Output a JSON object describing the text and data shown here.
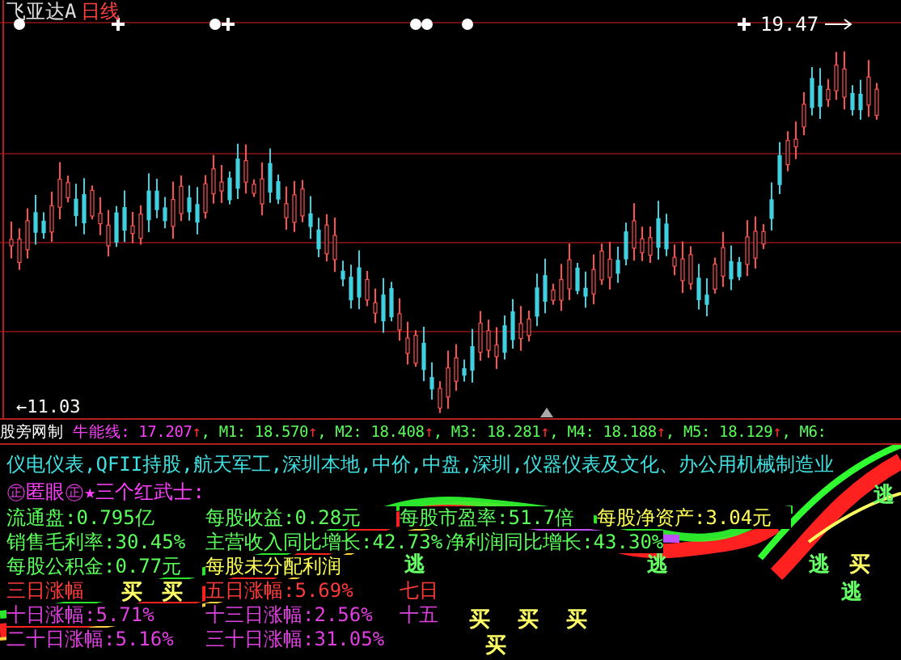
{
  "chart": {
    "stock": "飞亚达A",
    "period": "日线",
    "high_label": "19.47",
    "low_label": "←11.03"
  },
  "indicator": {
    "source": "股旁网制",
    "series": [
      {
        "label": "牛能线:",
        "value": " 17.207",
        "arrow": "↑",
        "sep": ", "
      },
      {
        "label": "M1:",
        "value": " 18.570",
        "arrow": "↑",
        "sep": ", "
      },
      {
        "label": "M2:",
        "value": " 18.408",
        "arrow": "↑",
        "sep": ", "
      },
      {
        "label": "M3:",
        "value": " 18.281",
        "arrow": "↑",
        "sep": ", "
      },
      {
        "label": "M4:",
        "value": " 18.188",
        "arrow": "↑",
        "sep": ", "
      },
      {
        "label": "M5:",
        "value": " 18.129",
        "arrow": "↑",
        "sep": ", "
      },
      {
        "label": "M6:"
      }
    ]
  },
  "tags": "仪电仪表,QFII持股,航天军工,深圳本地,中价,中盘,深圳,仪器仪表及文化、办公用机械制造业",
  "pattern": "㊣匿眼㊣★三个红武士:",
  "rows": [
    [
      {
        "kind": "fundamental",
        "text": "流通盘:0.795亿"
      },
      {
        "kind": "fundamental",
        "text": "每股收益:0.28元"
      },
      {
        "kind": "fundamental",
        "text": "每股市盈率:51.7倍"
      },
      {
        "kind": "highlight",
        "text": "每股净资产:3.04元"
      }
    ],
    [
      {
        "kind": "fundamental",
        "text": "销售毛利率:30.45%"
      },
      {
        "kind": "fundamental",
        "text": "主营收入同比增长:42.73%"
      },
      {
        "kind": "fundamental",
        "text": "净利润同比增长:43.30%"
      }
    ],
    [
      {
        "kind": "fundamental",
        "text": "每股公积金:0.77元"
      },
      {
        "kind": "highlight",
        "text": "每股未分配利润"
      }
    ],
    [
      {
        "kind": "short_rise",
        "text": "三日涨幅"
      },
      {
        "kind": "short_rise",
        "text": "五日涨幅:5.69%"
      },
      {
        "kind": "short_rise",
        "text": "七日"
      }
    ],
    [
      {
        "kind": "long_rise",
        "text": "十日涨幅:5.71%"
      },
      {
        "kind": "long_rise",
        "text": "十三日涨幅:2.56%"
      },
      {
        "kind": "long_rise",
        "text": "十五"
      }
    ],
    [
      {
        "kind": "long_rise",
        "text": "二十日涨幅:5.16%"
      },
      {
        "kind": "long_rise",
        "text": "三十日涨幅:31.05%"
      }
    ]
  ],
  "signals": [
    {
      "kind": "escape",
      "text": "逃"
    },
    {
      "kind": "escape",
      "text": "逃"
    },
    {
      "kind": "escape",
      "text": "逃"
    },
    {
      "kind": "escape",
      "text": "逃"
    },
    {
      "kind": "buy",
      "text": "买"
    },
    {
      "kind": "buy",
      "text": "买"
    },
    {
      "kind": "buy",
      "text": "买"
    },
    {
      "kind": "escape",
      "text": "逃"
    },
    {
      "kind": "buy",
      "text": "买"
    },
    {
      "kind": "buy",
      "text": "买"
    },
    {
      "kind": "buy",
      "text": "买"
    },
    {
      "kind": "buy",
      "text": "买"
    }
  ]
}
